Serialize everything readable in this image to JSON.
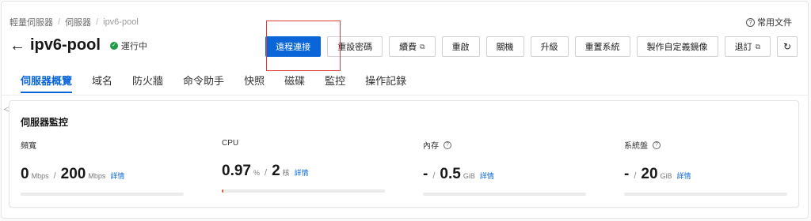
{
  "breadcrumb": [
    "輕量伺服器",
    "伺服器",
    "ipv6-pool"
  ],
  "help_link": "常用文件",
  "page_title": "ipv6-pool",
  "status": "運行中",
  "toolbar": {
    "remote_connect": "遠程連接",
    "reset_password": "重設密碼",
    "renew": "續費",
    "restart": "重啟",
    "shutdown": "關機",
    "upgrade": "升級",
    "reset_system": "重置系統",
    "create_image": "製作自定義鏡像",
    "refund": "退訂"
  },
  "tabs": [
    "伺服器概覽",
    "域名",
    "防火牆",
    "命令助手",
    "快照",
    "磁碟",
    "監控",
    "操作記錄"
  ],
  "monitor": {
    "title": "伺服器監控",
    "bandwidth": {
      "label": "頻寬",
      "value": "0",
      "unit": "Mbps",
      "total": "200",
      "total_unit": "Mbps",
      "detail": "詳情",
      "usage": 0
    },
    "cpu": {
      "label": "CPU",
      "value": "0.97",
      "unit": "%",
      "total": "2",
      "total_unit": "核",
      "detail": "詳情",
      "usage": 0.0097
    },
    "memory": {
      "label": "內存",
      "value": "-",
      "total": "0.5",
      "total_unit": "GiB",
      "detail": "詳情",
      "usage": 0
    },
    "disk": {
      "label": "系統盤",
      "value": "-",
      "total": "20",
      "total_unit": "GiB",
      "detail": "詳情",
      "usage": 0
    }
  },
  "colors": {
    "primary": "#0a66d8",
    "status_green": "#1f9a46",
    "highlight_red": "#e03a3a",
    "usage_orange": "#e2572b"
  },
  "icons": [
    "back-arrow-icon",
    "status-check-icon",
    "external-link-icon",
    "refresh-icon",
    "help-icon",
    "collapse-icon"
  ]
}
